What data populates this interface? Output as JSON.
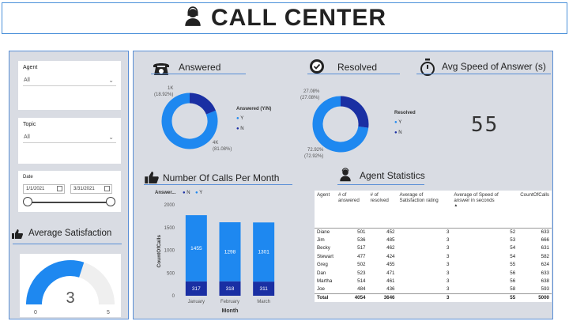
{
  "header": {
    "title": "CALL CENTER",
    "icon": "agent-icon"
  },
  "filters": {
    "agent": {
      "label": "Agent",
      "value": "All"
    },
    "topic": {
      "label": "Topic",
      "value": "All"
    },
    "date": {
      "label": "Date",
      "start": "1/1/2021",
      "end": "3/31/2021"
    }
  },
  "average_satisfaction": {
    "title": "Average Satisfaction",
    "value": "3",
    "min": "0",
    "max": "5",
    "fill_fraction": 0.6
  },
  "answered": {
    "title": "Answered",
    "legend_title": "Answered (Y/N)",
    "legend": [
      "Y",
      "N"
    ],
    "n_label": "1K",
    "n_pct": "(18.92%)",
    "y_label": "4K",
    "y_pct": "(81.08%)",
    "n_fraction": 0.1892
  },
  "resolved": {
    "title": "Resolved",
    "legend_title": "Resolved",
    "legend": [
      "Y",
      "N"
    ],
    "n_label": "27.08%",
    "n_pct": "(27.08%)",
    "y_label": "72.92%",
    "y_pct": "(72.92%)",
    "n_fraction": 0.2708
  },
  "speed": {
    "title": "Avg Speed of Answer (s)",
    "value": "55"
  },
  "calls_per_month": {
    "title": "Number Of Calls Per Month",
    "legend_title": "Answer...",
    "legend": [
      "N",
      "Y"
    ]
  },
  "chart_data": {
    "type": "bar",
    "categories": [
      "January",
      "February",
      "March"
    ],
    "series": [
      {
        "name": "N",
        "values": [
          317,
          318,
          311
        ],
        "color": "#1a2fa3"
      },
      {
        "name": "Y",
        "values": [
          1455,
          1298,
          1301
        ],
        "color": "#1e88f0"
      }
    ],
    "xlabel": "Month",
    "ylabel": "CountOfCalls",
    "ylim": [
      0,
      2000
    ],
    "yticks": [
      "0",
      "500",
      "1000",
      "1500",
      "2000"
    ],
    "stacked": true
  },
  "agent_stats": {
    "title": "Agent Statistics",
    "columns": [
      "Agent",
      "# of answered",
      "# of resolved",
      "Average of Satisfaction rating",
      "Average of Speed of answer in seconds",
      "CountOfCalls"
    ],
    "rows": [
      [
        "Diane",
        "501",
        "452",
        "3",
        "52",
        "633"
      ],
      [
        "Jim",
        "536",
        "485",
        "3",
        "53",
        "666"
      ],
      [
        "Becky",
        "517",
        "462",
        "3",
        "54",
        "631"
      ],
      [
        "Stewart",
        "477",
        "424",
        "3",
        "54",
        "582"
      ],
      [
        "Greg",
        "502",
        "455",
        "3",
        "55",
        "624"
      ],
      [
        "Dan",
        "523",
        "471",
        "3",
        "56",
        "633"
      ],
      [
        "Martha",
        "514",
        "461",
        "3",
        "56",
        "638"
      ],
      [
        "Joe",
        "484",
        "436",
        "3",
        "58",
        "593"
      ]
    ],
    "total": [
      "Total",
      "4054",
      "3646",
      "3",
      "55",
      "5000"
    ]
  },
  "colors": {
    "primary": "#1e88f0",
    "dark": "#1a2fa3",
    "panel": "#d9dce3",
    "border": "#5a8fd6"
  }
}
